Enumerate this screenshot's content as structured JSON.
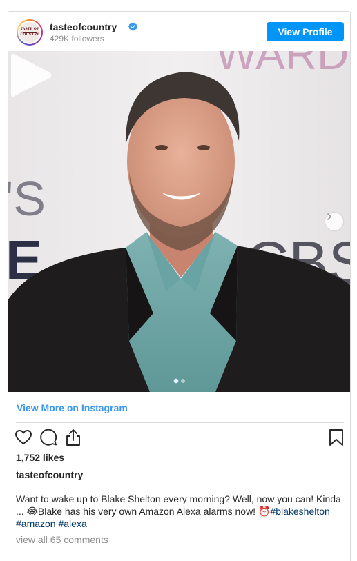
{
  "header": {
    "avatar_text_top": "TASTE OF",
    "avatar_text_bottom": "COUNTRY",
    "username": "tasteofcountry",
    "followers": "429K followers",
    "view_profile_label": "View Profile"
  },
  "media": {
    "icon_play": "play-icon",
    "icon_next": "chevron-right-icon",
    "carousel_count": 2,
    "carousel_active": 0
  },
  "view_more_label": "View More on Instagram",
  "actions": {
    "like_icon": "heart-icon",
    "comment_icon": "comment-icon",
    "share_icon": "share-icon",
    "save_icon": "bookmark-icon"
  },
  "likes": "1,752 likes",
  "caption": {
    "username": "tasteofcountry",
    "text_line": "Want to wake up to Blake Shelton every morning? Well, now you can! Kinda ... ",
    "emoji_laugh": "😂",
    "text_after_emoji": "Blake has his very own Amazon Alexa alarms now! ",
    "emoji_clock": "⏰",
    "hashtags": [
      "#blakeshelton",
      "#amazon",
      "#alexa"
    ]
  },
  "comments_label": "view all 65 comments",
  "colors": {
    "accent": "#0095f6",
    "link": "#3897f0",
    "hashtag": "#00376b",
    "muted": "#8e8e8e"
  }
}
